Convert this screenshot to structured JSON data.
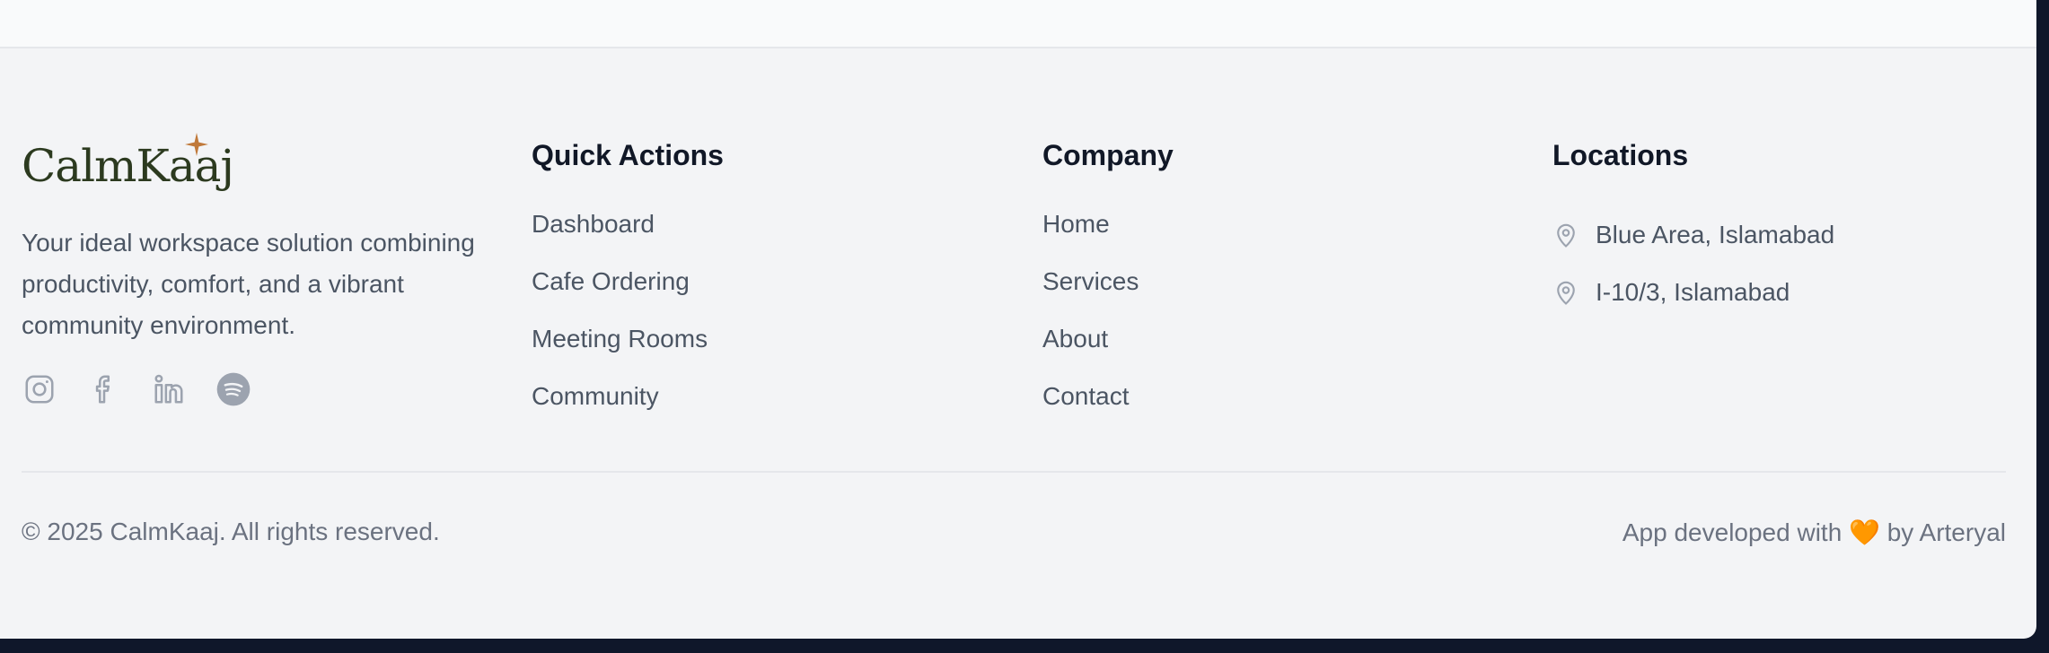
{
  "brand": {
    "name": "CalmKaaj",
    "tagline": "Your ideal workspace solution combining productivity, comfort, and a vibrant community environment.",
    "accent_color": "#c0793a",
    "text_color": "#2c3a1f"
  },
  "socials": [
    {
      "icon": "instagram-icon"
    },
    {
      "icon": "facebook-icon"
    },
    {
      "icon": "linkedin-icon"
    },
    {
      "icon": "spotify-icon"
    }
  ],
  "quick_actions": {
    "title": "Quick Actions",
    "items": [
      "Dashboard",
      "Cafe Ordering",
      "Meeting Rooms",
      "Community"
    ]
  },
  "company": {
    "title": "Company",
    "items": [
      "Home",
      "Services",
      "About",
      "Contact"
    ]
  },
  "locations": {
    "title": "Locations",
    "icon": "map-pin-icon",
    "items": [
      "Blue Area, Islamabad",
      "I-10/3, Islamabad"
    ]
  },
  "footer": {
    "copyright": "© 2025 CalmKaaj. All rights reserved.",
    "credit_prefix": "App developed with",
    "credit_emoji": "🧡",
    "credit_suffix": "by Arteryal"
  }
}
